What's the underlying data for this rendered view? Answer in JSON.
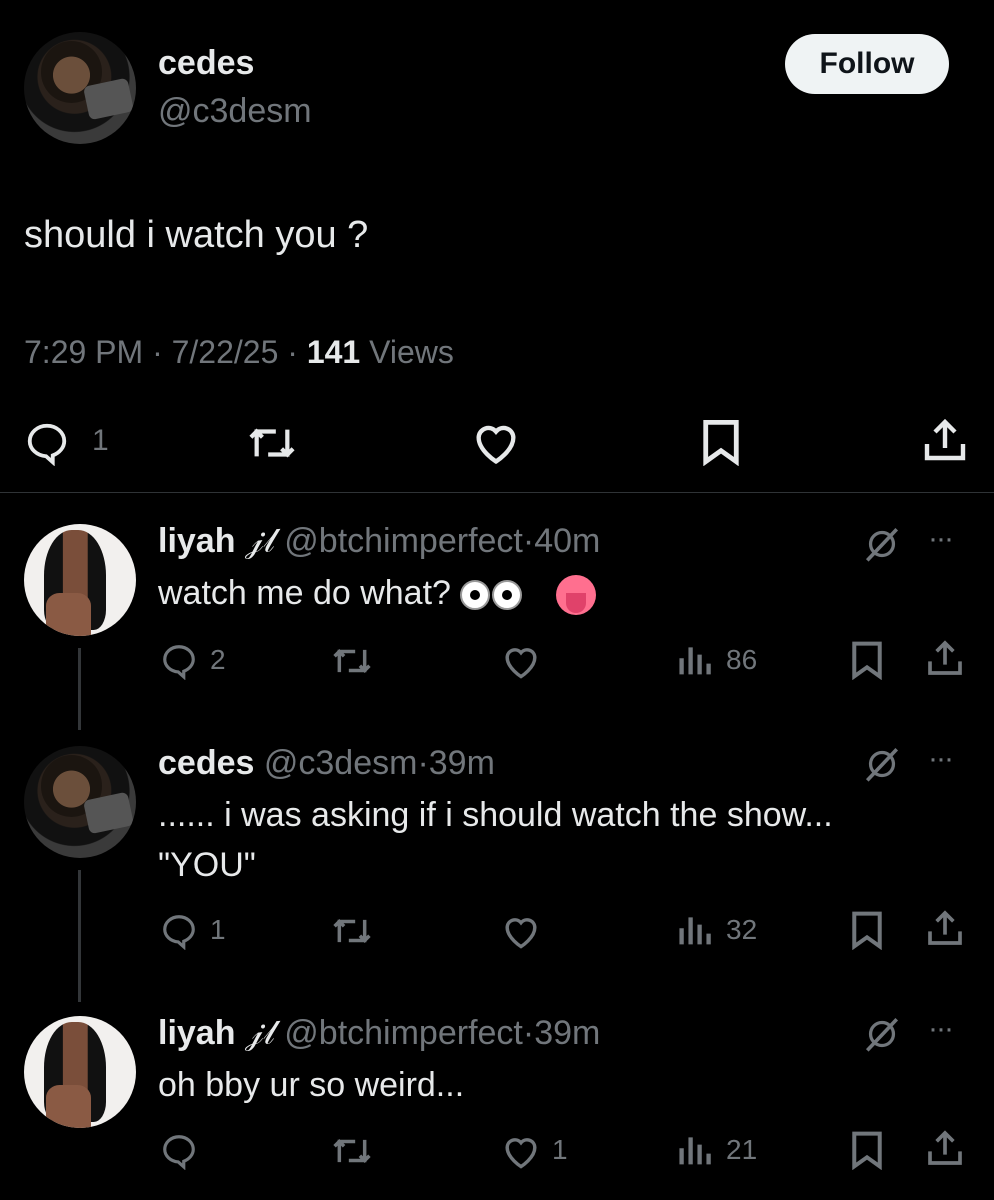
{
  "main_tweet": {
    "author_name": "cedes",
    "handle": "@c3desm",
    "follow_label": "Follow",
    "text": "should i watch you ?",
    "time": "7:29 PM",
    "date": "7/22/25",
    "views_count": "141",
    "views_label": "Views",
    "reply_count": "1"
  },
  "replies": [
    {
      "author_name": "liyah",
      "name_glyph": "𝒿𝓁",
      "handle": "@btchimperfect",
      "time": "40m",
      "text": "watch me do what?",
      "reply_count": "2",
      "like_count": "",
      "views_count": "86"
    },
    {
      "author_name": "cedes",
      "handle": "@c3desm",
      "time": "39m",
      "text_line1": "...... i was asking if i should watch the show...",
      "text_line2": "\"YOU\"",
      "reply_count": "1",
      "like_count": "",
      "views_count": "32"
    },
    {
      "author_name": "liyah",
      "name_glyph": "𝒿𝓁",
      "handle": "@btchimperfect",
      "time": "39m",
      "text": "oh bby ur so weird...",
      "reply_count": "",
      "like_count": "1",
      "views_count": "21"
    }
  ],
  "separator": "·",
  "more_label": "···",
  "colors": {
    "background": "#000000",
    "text": "#e7e9ea",
    "muted": "#71767b"
  }
}
